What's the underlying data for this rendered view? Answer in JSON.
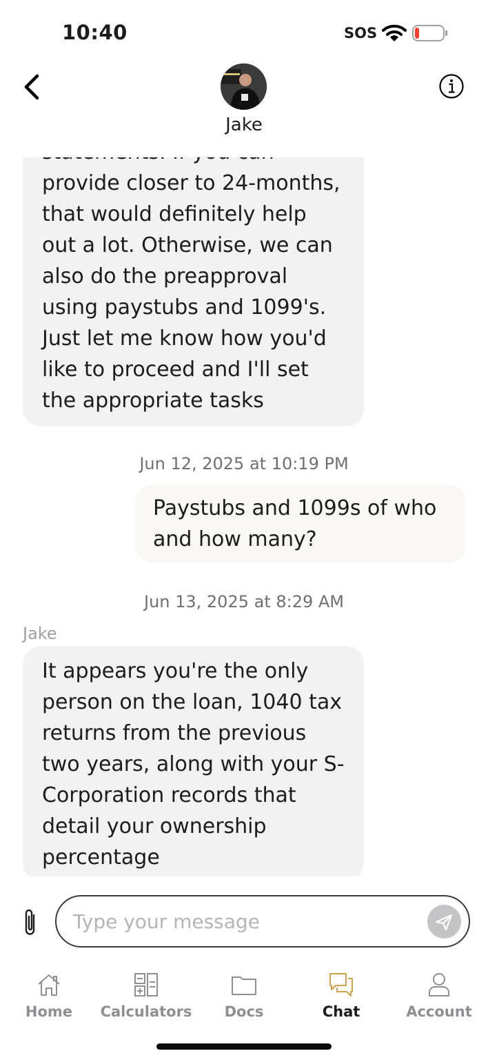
{
  "status_bar": {
    "time": "10:40",
    "sos": "SOS",
    "battery_level": 0.1,
    "battery_color": "#ff3b30"
  },
  "header": {
    "contact_name": "Jake",
    "back_icon": "chevron-left-icon",
    "info_icon": "info-icon"
  },
  "messages": {
    "msg1": {
      "direction": "incoming",
      "lines": [
        "statements. If you can",
        "provide closer to 24-months,",
        "that would definitely help",
        "out a lot. Otherwise, we can",
        "also do the preapproval",
        "using paystubs and 1099's.",
        "Just let me know how you'd",
        "like to proceed and I'll set",
        "the appropriate tasks"
      ]
    },
    "ts1": "Jun 12, 2025 at 10:19 PM",
    "msg2": {
      "direction": "outgoing",
      "lines": [
        "Paystubs and 1099s of who",
        "and how many?"
      ]
    },
    "ts2": "Jun 13, 2025 at 8:29 AM",
    "sender3": "Jake",
    "msg3": {
      "direction": "incoming",
      "lines": [
        "It appears you're the only",
        "person on the loan, 1040 tax",
        "returns from the previous",
        "two years, along with your S-",
        "Corporation records that",
        "detail your ownership",
        "percentage"
      ]
    }
  },
  "composer": {
    "placeholder": "Type your message",
    "value": "",
    "attach_icon": "paperclip-icon",
    "send_icon": "send-icon"
  },
  "tabbar": {
    "active_color": "#d4a24c",
    "tabs": [
      {
        "label": "Home",
        "icon": "home-icon"
      },
      {
        "label": "Calculators",
        "icon": "calculator-icon"
      },
      {
        "label": "Docs",
        "icon": "folder-icon"
      },
      {
        "label": "Chat",
        "icon": "chat-icon",
        "active": true
      },
      {
        "label": "Account",
        "icon": "user-icon"
      }
    ]
  }
}
